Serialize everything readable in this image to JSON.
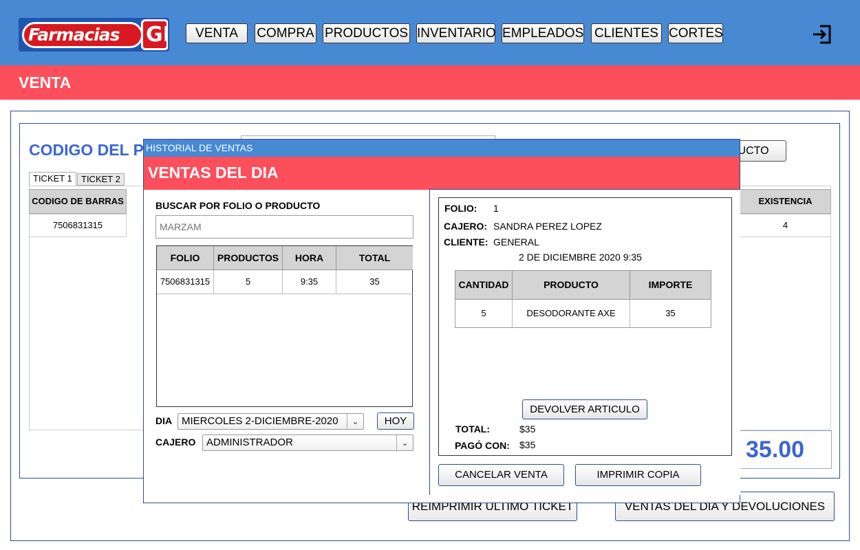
{
  "logo": {
    "text": "Farmacias",
    "badge": "GI"
  },
  "nav": {
    "items": [
      "VENTA",
      "COMPRA",
      "PRODUCTOS",
      "INVENTARIO",
      "EMPLEADOS",
      "CLIENTES",
      "CORTES"
    ]
  },
  "section_title": "VENTA",
  "background": {
    "title": "CODIGO DEL P",
    "add_button_label": "DUCTO",
    "tabs": [
      "TICKET 1",
      "TICKET 2"
    ],
    "columns": {
      "barcode": "CODIGO DE BARRAS",
      "stock": "EXISTENCIA"
    },
    "row": {
      "barcode": "7506831315",
      "stock": "4"
    },
    "total": "35.00",
    "reprint_button": "REIMPRIMIR ULTIMO TICKET",
    "daily_sales_button": "VENTAS DEL DIA Y DEVOLUCIONES"
  },
  "modal": {
    "window_title": "HISTORIAL DE VENTAS",
    "header": "VENTAS DEL DIA",
    "search_label": "BUSCAR POR FOLIO O PRODUCTO",
    "search_placeholder": "MARZAM",
    "list": {
      "columns": [
        "FOLIO",
        "PRODUCTOS",
        "HORA",
        "TOTAL"
      ],
      "rows": [
        {
          "folio": "7506831315",
          "productos": "5",
          "hora": "9:35",
          "total": "35"
        }
      ]
    },
    "day_label": "DIA",
    "day_value": "MIERCOLES 2-DICIEMBRE-2020",
    "today_button": "HOY",
    "cashier_label": "CAJERO",
    "cashier_value": "ADMINISTRADOR",
    "detail": {
      "folio_label": "FOLIO:",
      "folio_value": "1",
      "cashier_label": "CAJERO:",
      "cashier_value": "SANDRA PEREZ LOPEZ",
      "client_label": "CLIENTE:",
      "client_value": "GENERAL",
      "date": "2 DE DICIEMBRE 2020 9:35",
      "columns": [
        "CANTIDAD",
        "PRODUCTO",
        "IMPORTE"
      ],
      "items": [
        {
          "cantidad": "5",
          "producto": "DESODORANTE AXE",
          "importe": "35"
        }
      ],
      "return_button": "DEVOLVER ARTICULO",
      "total_label": "TOTAL:",
      "total_value": "$35",
      "paid_label": "PAGÓ CON:",
      "paid_value": "$35"
    },
    "cancel_button": "CANCELAR VENTA",
    "print_button": "IMPRIMIR COPIA"
  }
}
